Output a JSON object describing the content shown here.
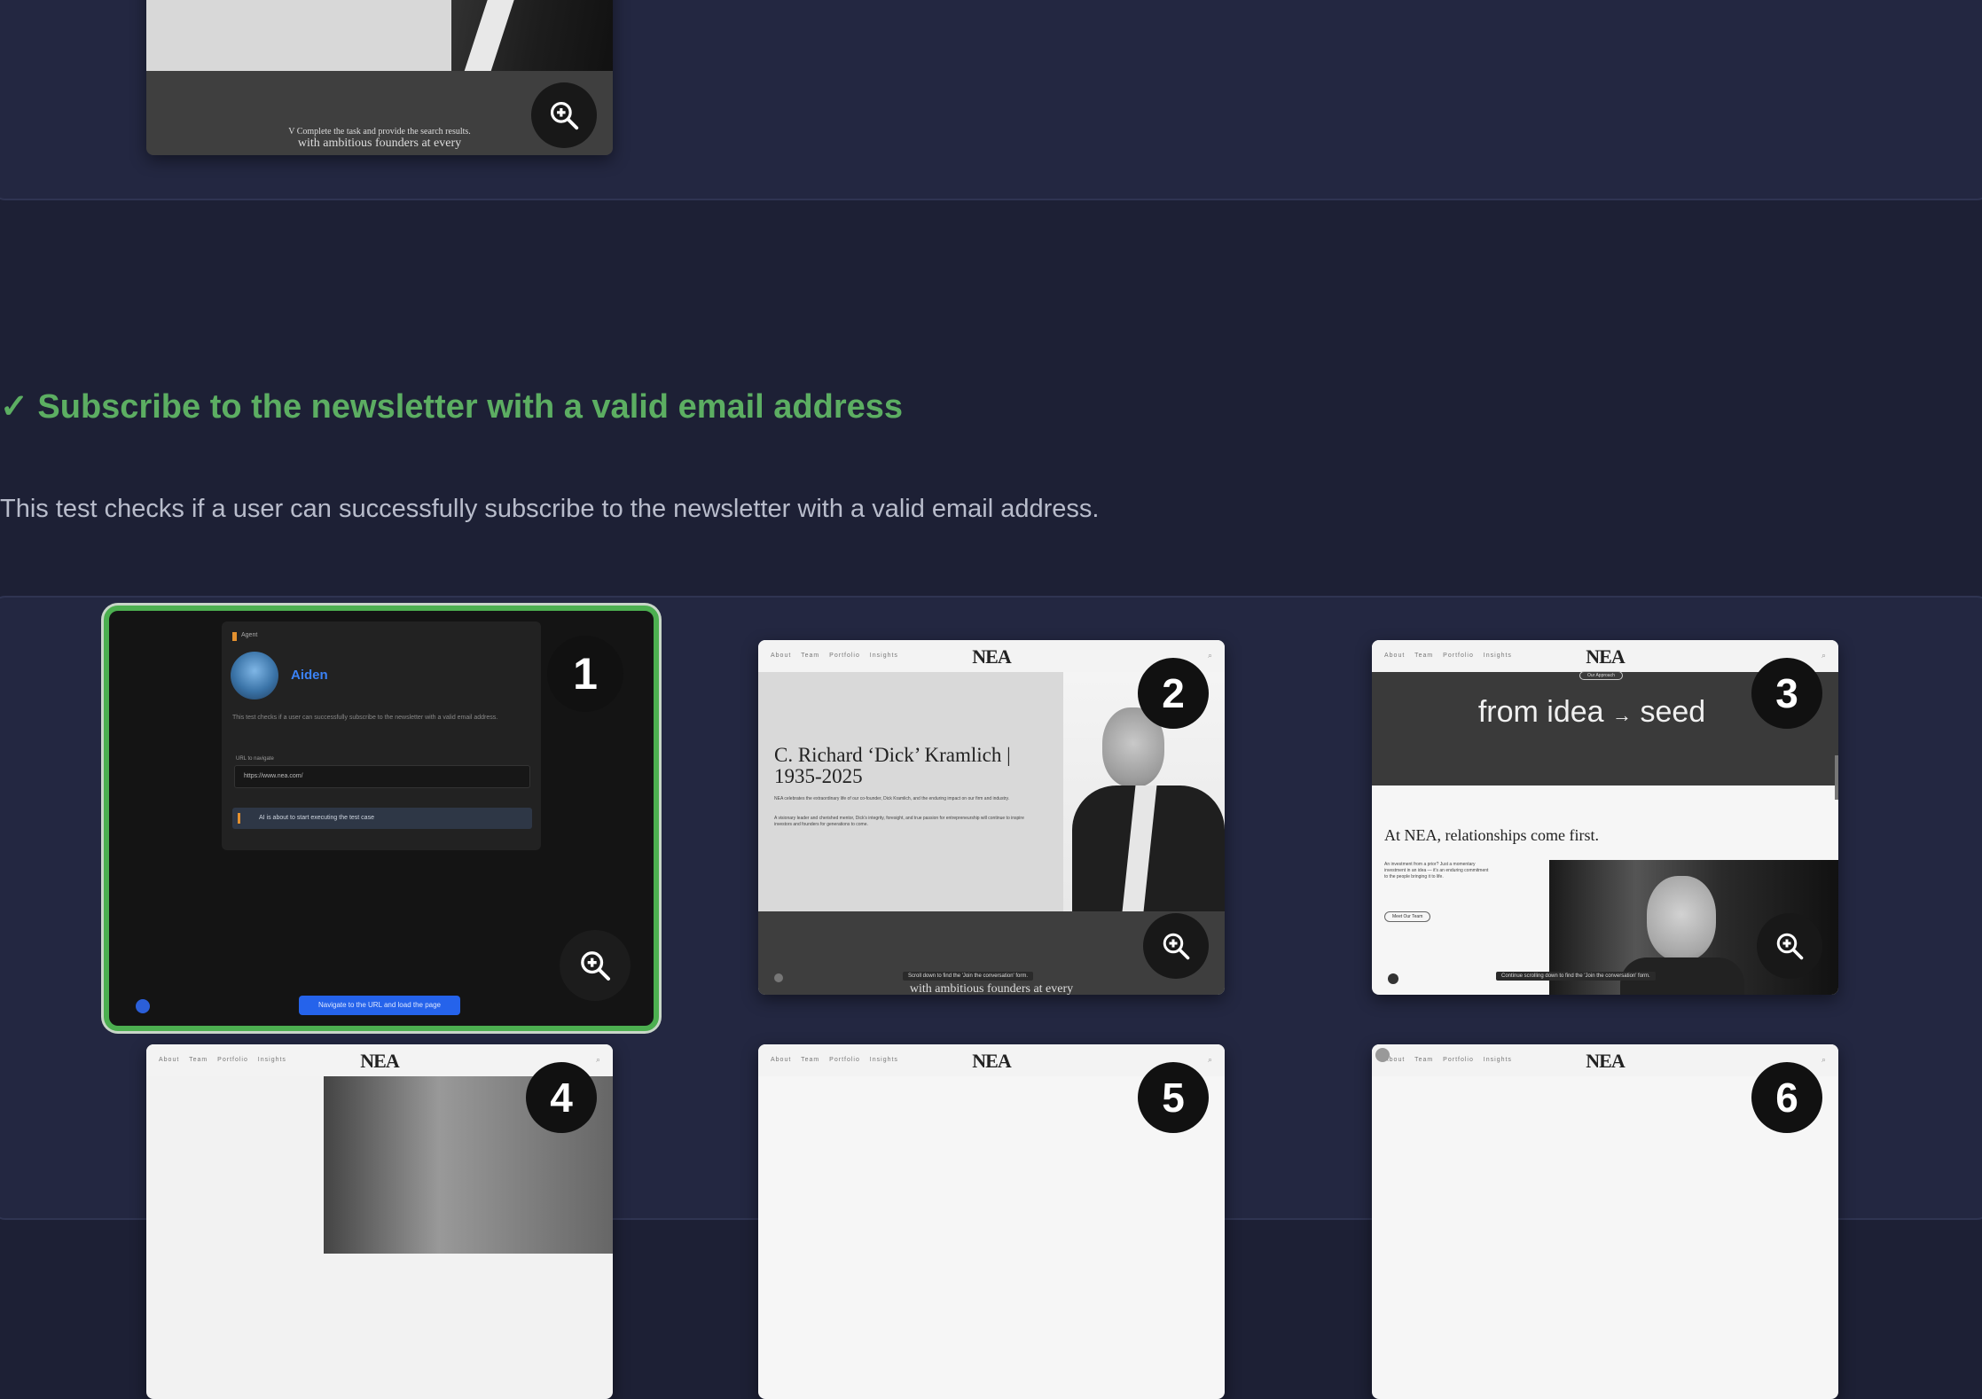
{
  "previous_test": {
    "thumb_caption": "V Complete the task and provide the search results.",
    "thumb_caption_2": "with ambitious founders at every"
  },
  "test": {
    "check_glyph": "✓",
    "title": "Subscribe to the newsletter with a valid email address",
    "description": "This test checks if a user can successfully subscribe to the newsletter with a valid email address."
  },
  "steps": [
    {
      "number": "1",
      "selected": true,
      "agent_label": "Agent",
      "agent_name": "Aiden",
      "body_text": "This test checks if a user can successfully subscribe to the newsletter with a valid email address.",
      "url_label": "URL to navigate",
      "url_value": "https://www.nea.com/",
      "status_text": "AI is about to start executing the test case",
      "action_text": "Navigate to the URL and load the page"
    },
    {
      "number": "2",
      "selected": false,
      "nav_links": "About Team Portfolio Insights",
      "logo": "NEA",
      "headline": "C. Richard ‘Dick’ Kramlich | 1935-2025",
      "para1": "NEA celebrates the extraordinary life of our co-founder, Dick Kramlich, and the enduring impact on our firm and industry.",
      "para2": "A visionary leader and cherished mentor, Dick's integrity, foresight, and true passion for entrepreneurship will continue to inspire investors and founders for generations to come.",
      "tooltip": "Scroll down to find the 'Join the conversation' form.",
      "caption": "with ambitious founders at every"
    },
    {
      "number": "3",
      "selected": false,
      "nav_links": "About Team Portfolio Insights",
      "logo": "NEA",
      "pill": "Our Approach",
      "hero_left": "from idea",
      "hero_arrow": "→",
      "hero_right": "seed",
      "subhead": "At NEA, relationships come first.",
      "para": "An investment from a prior? Just a momentary investment in an idea — it's an enduring commitment to the people bringing it to life.",
      "button": "Meet Our Team",
      "tooltip": "Continue scrolling down to find the 'Join the conversation' form."
    },
    {
      "number": "4",
      "logo": "NEA",
      "nav_links": "About Team Portfolio Insights"
    },
    {
      "number": "5",
      "logo": "NEA",
      "nav_links": "About Team Portfolio Insights"
    },
    {
      "number": "6",
      "logo": "NEA",
      "nav_links": "About Team Portfolio Insights"
    }
  ],
  "icons": {
    "zoom": "zoom-in-icon",
    "check": "check-icon"
  },
  "colors": {
    "background": "#1d2035",
    "panel": "#232741",
    "success": "#5cae62",
    "selected_border": "#4caf50"
  }
}
